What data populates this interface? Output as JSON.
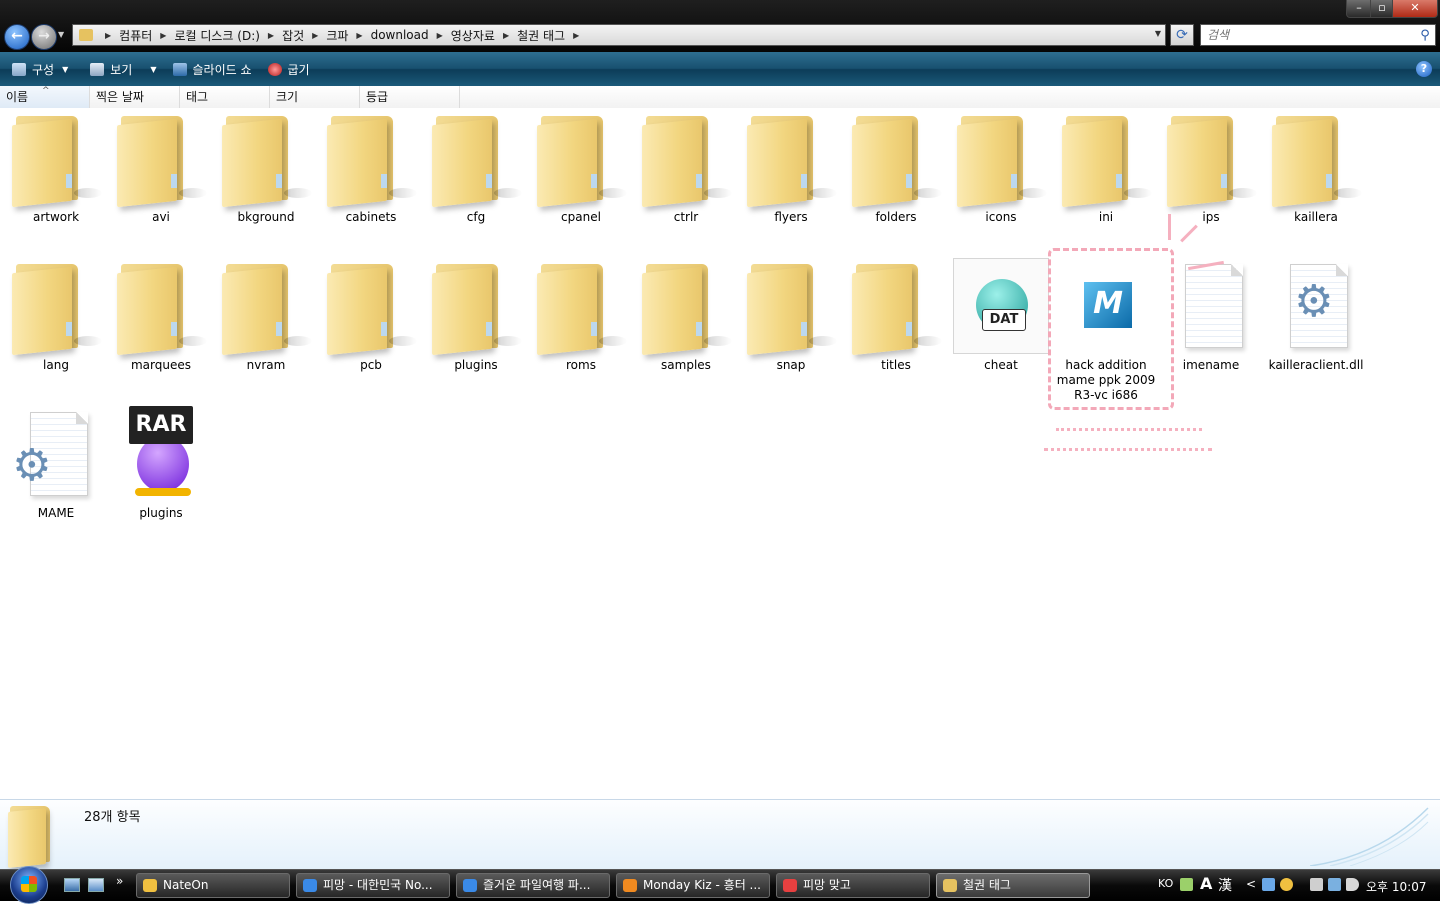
{
  "window": {
    "address": [
      "컴퓨터",
      "로컬 디스크 (D:)",
      "잡것",
      "크파",
      "download",
      "영상자료",
      "철권 태그"
    ],
    "search_placeholder": "검색",
    "controls": {
      "minimize": "–",
      "maximize": "▫",
      "close": "✕"
    }
  },
  "commandbar": {
    "organize": "구성",
    "views": "보기",
    "slideshow": "슬라이드 쇼",
    "burn": "굽기",
    "help": "?"
  },
  "columns": {
    "name": "이름",
    "date": "찍은 날짜",
    "tags": "태그",
    "size": "크기",
    "rating": "등급"
  },
  "items": [
    {
      "name": "artwork",
      "type": "folder"
    },
    {
      "name": "avi",
      "type": "folder"
    },
    {
      "name": "bkground",
      "type": "folder"
    },
    {
      "name": "cabinets",
      "type": "folder"
    },
    {
      "name": "cfg",
      "type": "folder"
    },
    {
      "name": "cpanel",
      "type": "folder"
    },
    {
      "name": "ctrlr",
      "type": "folder"
    },
    {
      "name": "flyers",
      "type": "folder"
    },
    {
      "name": "folders",
      "type": "folder"
    },
    {
      "name": "icons",
      "type": "folder"
    },
    {
      "name": "ini",
      "type": "folder"
    },
    {
      "name": "ips",
      "type": "folder"
    },
    {
      "name": "kaillera",
      "type": "folder"
    },
    {
      "name": "lang",
      "type": "folder"
    },
    {
      "name": "marquees",
      "type": "folder"
    },
    {
      "name": "nvram",
      "type": "folder"
    },
    {
      "name": "pcb",
      "type": "folder"
    },
    {
      "name": "plugins",
      "type": "folder"
    },
    {
      "name": "roms",
      "type": "folder"
    },
    {
      "name": "samples",
      "type": "folder"
    },
    {
      "name": "snap",
      "type": "folder"
    },
    {
      "name": "titles",
      "type": "folder"
    },
    {
      "name": "cheat",
      "type": "dat",
      "icon_text": "DAT"
    },
    {
      "name": "hack addition mame ppk 2009 R3-vc i686",
      "type": "mame-exe"
    },
    {
      "name": "imename",
      "type": "document"
    },
    {
      "name": "kailleraclient.dll",
      "type": "dll"
    },
    {
      "name": "MAME",
      "type": "config"
    },
    {
      "name": "plugins",
      "type": "rar",
      "icon_text": "RAR"
    }
  ],
  "details": {
    "item_count": "28개 항목"
  },
  "taskbar": {
    "quicklaunch_more": "»",
    "tasks": [
      {
        "label": "NateOn",
        "color": "#f0c040"
      },
      {
        "label": "피망 - 대한민국 No...",
        "color": "#3a8ae8"
      },
      {
        "label": "즐거운 파일여행 파...",
        "color": "#3a8ae8"
      },
      {
        "label": "Monday Kiz - 흥터 ...",
        "color": "#f08a20"
      },
      {
        "label": "피망 맞고",
        "color": "#e84040"
      },
      {
        "label": "철권 태그",
        "color": "#e6c260"
      }
    ],
    "tray": {
      "lang": "KO",
      "ime_a": "A",
      "ime_han": "漢",
      "expand": "<",
      "clock": "오후 10:07"
    }
  }
}
